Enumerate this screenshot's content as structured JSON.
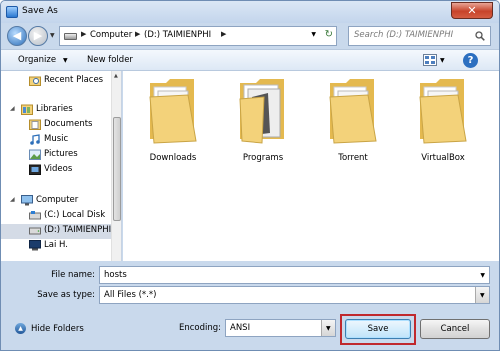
{
  "window": {
    "title": "Save As",
    "close_glyph": "✕"
  },
  "navigation": {
    "back_glyph": "◀",
    "forward_glyph": "▶",
    "breadcrumb": [
      {
        "label": "Computer"
      },
      {
        "label": "(D:) TAIMIENPHI"
      }
    ],
    "search_placeholder": "Search (D:) TAIMIENPHI"
  },
  "toolbar": {
    "organize_label": "Organize",
    "new_folder_label": "New folder",
    "help_glyph": "?"
  },
  "sidebar": {
    "items": [
      {
        "label": "Recent Places",
        "icon": "recent-places-icon"
      },
      {
        "label": "Libraries",
        "icon": "libraries-icon"
      },
      {
        "label": "Documents",
        "icon": "documents-icon"
      },
      {
        "label": "Music",
        "icon": "music-icon"
      },
      {
        "label": "Pictures",
        "icon": "pictures-icon"
      },
      {
        "label": "Videos",
        "icon": "videos-icon"
      },
      {
        "label": "Computer",
        "icon": "computer-icon"
      },
      {
        "label": "(C:) Local Disk",
        "icon": "local-disk-icon"
      },
      {
        "label": "(D:) TAIMIENPHI",
        "icon": "drive-icon",
        "selected": true
      },
      {
        "label": "Lai H.",
        "icon": "network-user-icon"
      }
    ]
  },
  "folders": [
    {
      "name": "Downloads"
    },
    {
      "name": "Programs"
    },
    {
      "name": "Torrent"
    },
    {
      "name": "VirtualBox"
    }
  ],
  "form": {
    "file_name_label": "File name:",
    "file_name_value": "hosts",
    "save_as_type_label": "Save as type:",
    "save_as_type_value": "All Files  (*.*)",
    "encoding_label": "Encoding:",
    "encoding_value": "ANSI"
  },
  "footer": {
    "hide_folders_label": "Hide Folders",
    "save_label": "Save",
    "cancel_label": "Cancel"
  },
  "colors": {
    "highlight": "#c0282d",
    "folder": "#f3d27a"
  }
}
